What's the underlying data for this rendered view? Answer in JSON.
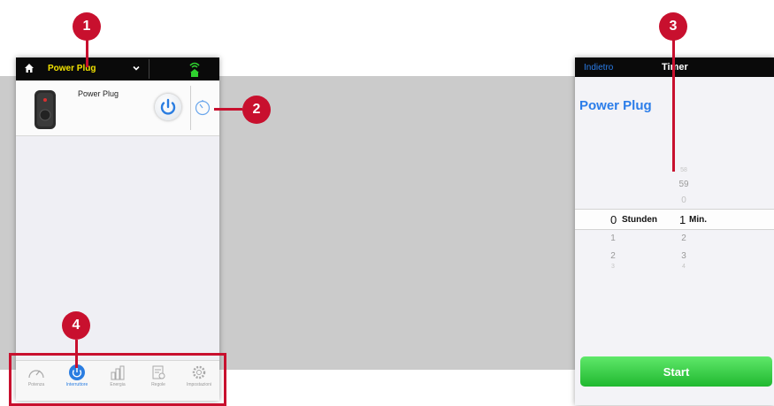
{
  "left_app": {
    "selected_device": "Power Plug",
    "device_card": {
      "name": "Power Plug"
    },
    "tabs": [
      {
        "label": "Potenza",
        "icon": "gauge-icon",
        "active": false
      },
      {
        "label": "Interruttore",
        "icon": "power-switch-icon",
        "active": true
      },
      {
        "label": "Energia",
        "icon": "bar-chart-icon",
        "active": false
      },
      {
        "label": "Regole",
        "icon": "calendar-rules-icon",
        "active": false
      },
      {
        "label": "Impostazioni",
        "icon": "gear-icon",
        "active": false
      }
    ]
  },
  "right_app": {
    "back_label": "Indietro",
    "title": "Timer",
    "device_name": "Power Plug",
    "picker": {
      "hours_selected": "0",
      "hours_unit": "Stunden",
      "hours_below": [
        "1",
        "2",
        "3"
      ],
      "minutes_above": [
        "58",
        "59",
        "0"
      ],
      "minutes_selected": "1",
      "minutes_unit": "Min.",
      "minutes_below": [
        "2",
        "3",
        "4"
      ]
    },
    "start_label": "Start"
  },
  "callouts": [
    "1",
    "2",
    "3",
    "4"
  ],
  "colors": {
    "accent_red": "#c8102e",
    "link_blue": "#2b7de9",
    "start_green": "#2cc23c",
    "device_yellow": "#f2e200",
    "signal_green": "#2fd12f"
  }
}
